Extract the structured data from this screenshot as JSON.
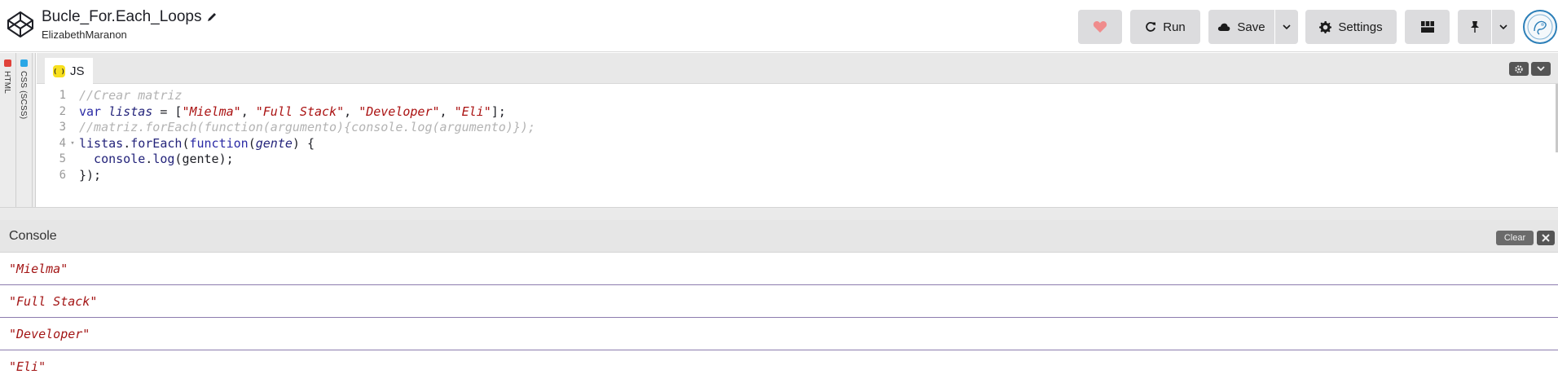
{
  "header": {
    "title": "Bucle_For.Each_Loops",
    "author": "ElizabethMaranon",
    "buttons": {
      "run": "Run",
      "save": "Save",
      "settings": "Settings"
    }
  },
  "side_tabs": [
    {
      "label": "HTML",
      "color": "#e0423a"
    },
    {
      "label": "CSS (SCSS)",
      "color": "#2aa7e6"
    }
  ],
  "editor": {
    "tab_label": "JS",
    "tab_badge": "( )",
    "lines": [
      {
        "num": "1",
        "fold": "",
        "tokens": [
          {
            "t": "//Crear matriz",
            "c": "c-comment"
          }
        ]
      },
      {
        "num": "2",
        "fold": "",
        "tokens": [
          {
            "t": "var",
            "c": "c-kw"
          },
          {
            "t": " ",
            "c": "c-plain"
          },
          {
            "t": "listas",
            "c": "c-var"
          },
          {
            "t": " = [",
            "c": "c-plain"
          },
          {
            "t": "\"Mielma\"",
            "c": "c-str"
          },
          {
            "t": ", ",
            "c": "c-plain"
          },
          {
            "t": "\"Full Stack\"",
            "c": "c-str"
          },
          {
            "t": ", ",
            "c": "c-plain"
          },
          {
            "t": "\"Developer\"",
            "c": "c-str"
          },
          {
            "t": ", ",
            "c": "c-plain"
          },
          {
            "t": "\"Eli\"",
            "c": "c-str"
          },
          {
            "t": "];",
            "c": "c-plain"
          }
        ]
      },
      {
        "num": "3",
        "fold": "",
        "tokens": [
          {
            "t": "//matriz.forEach(function(argumento){console.log(argumento)});",
            "c": "c-comment"
          }
        ]
      },
      {
        "num": "4",
        "fold": "▾",
        "tokens": [
          {
            "t": "listas",
            "c": "c-prop"
          },
          {
            "t": ".",
            "c": "c-plain"
          },
          {
            "t": "forEach",
            "c": "c-prop"
          },
          {
            "t": "(",
            "c": "c-plain"
          },
          {
            "t": "function",
            "c": "c-kw"
          },
          {
            "t": "(",
            "c": "c-plain"
          },
          {
            "t": "gente",
            "c": "c-var"
          },
          {
            "t": ") {",
            "c": "c-plain"
          }
        ]
      },
      {
        "num": "5",
        "fold": "",
        "tokens": [
          {
            "t": "  console",
            "c": "c-prop"
          },
          {
            "t": ".",
            "c": "c-plain"
          },
          {
            "t": "log",
            "c": "c-prop"
          },
          {
            "t": "(",
            "c": "c-plain"
          },
          {
            "t": "gente",
            "c": "c-plain"
          },
          {
            "t": ");",
            "c": "c-plain"
          }
        ]
      },
      {
        "num": "6",
        "fold": "",
        "tokens": [
          {
            "t": "});",
            "c": "c-plain"
          }
        ]
      }
    ]
  },
  "console": {
    "title": "Console",
    "clear_label": "Clear",
    "entries": [
      "\"Mielma\"",
      "\"Full Stack\"",
      "\"Developer\"",
      "\"Eli\""
    ]
  }
}
